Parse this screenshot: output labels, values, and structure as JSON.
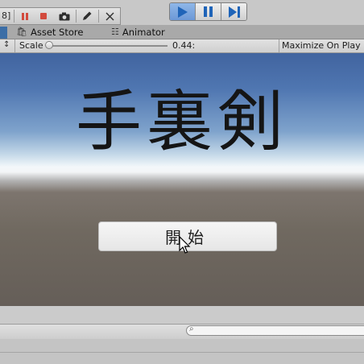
{
  "toolbar": {
    "left_group_fragment": "8]",
    "icons": [
      "record-square-icon",
      "pause-red-icon",
      "stop-square-icon",
      "camera-icon",
      "pencil-icon",
      "close-icon"
    ],
    "play_controls": {
      "play_icon": "play-icon",
      "pause_icon": "pause-icon",
      "step_icon": "step-icon",
      "playing": true,
      "accent": "#1f64b8"
    }
  },
  "tabs": [
    {
      "label": "Asset Store",
      "icon": "shopping-bag-icon"
    },
    {
      "label": "Animator",
      "icon": "animator-icon"
    }
  ],
  "game_toolbar": {
    "scale_label": "Scale",
    "scale_value": "0.44:",
    "maximize_label": "Maximize On Play"
  },
  "game": {
    "title": "手裏剣",
    "start_button_label": "開始"
  }
}
